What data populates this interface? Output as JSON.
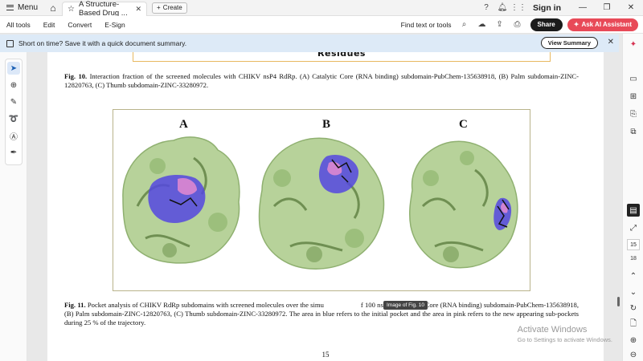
{
  "titlebar": {
    "menu_label": "Menu",
    "tab_title": "A Structure-Based Drug ...",
    "create_label": "Create",
    "signin_label": "Sign in"
  },
  "toolbar": {
    "menus": [
      "All tools",
      "Edit",
      "Convert",
      "E-Sign"
    ],
    "find_label": "Find text or tools",
    "share_label": "Share",
    "ai_label": "Ask AI Assistant"
  },
  "banner": {
    "text": "Short on time? Save it with a quick document summary.",
    "button_label": "View Summary"
  },
  "document": {
    "residues_heading": "Residues",
    "fig10_label": "Fig. 10.",
    "fig10_text": " Interaction fraction of the screened molecules with CHIKV nsP4 RdRp. (A) Catalytic Core (RNA binding) subdomain-PubChem-135638918, (B) Palm subdomain-ZINC-12820763, (C) Thumb subdomain-ZINC-33280972.",
    "panel_labels": [
      "A",
      "B",
      "C"
    ],
    "fig11_label": "Fig. 11.",
    "fig11_text": " Pocket analysis of CHIKV RdRp subdomains with screened molecules over the simu",
    "fig11_text_rest": "f 100 ns. (A) Catalytic Core (RNA binding) subdomain-PubChem-135638918, (B) Palm subdomain-ZINC-12820763, (C) Thumb subdomain-ZINC-33280972. The area in blue refers to the initial pocket and the area in pink refers to the new appearing sub-pockets during 25 % of the trajectory.",
    "tooltip": "Image of Fig. 10",
    "page_number": "15"
  },
  "watermark": {
    "line1": "Activate Windows",
    "line2": "Go to Settings to activate Windows."
  },
  "right_rail": {
    "current_page": "15",
    "total_pages": "18"
  },
  "colors": {
    "protein_green": "#a9c98a",
    "protein_dark": "#6f8f52",
    "pocket_blue": "#5548e0",
    "pocket_pink": "#e48ad0",
    "ai_red": "#e84a58"
  }
}
